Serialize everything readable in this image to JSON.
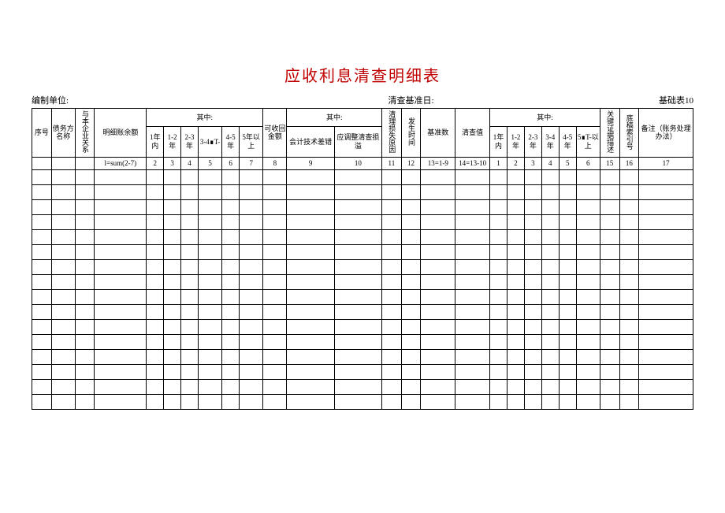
{
  "title": "应收利息清查明细表",
  "meta": {
    "left_label": "编制单位:",
    "center_label": "清查基准日:",
    "right_label": "基础表10"
  },
  "headers": {
    "seq": "序号",
    "debtor": "债务方名称",
    "relation": "与本企业关系",
    "balance": "明细账余额",
    "qizhong": "其中:",
    "y1": "1年内",
    "y12": "1-2年",
    "y23": "2-3年",
    "y34": "3-4年",
    "y34t": "3-4∎T-",
    "y45": "4-5年",
    "y5p": "5年以上",
    "y5pt": "5∎T-以上",
    "recoverable": "可收回金额",
    "acct_err": "会计技术差错",
    "adj_loss": "应调整清查损溢",
    "loss_reason": "清理损失原因",
    "occur_time": "发生时间",
    "base_num": "基准数",
    "audit_val": "清查值",
    "evidence": "关键证据描述",
    "ref_no": "底稿索引号",
    "remark": "备注（账务处理办法）"
  },
  "row_nums": {
    "c1": "l=sum(2-7)",
    "c2": "2",
    "c3": "3",
    "c4": "4",
    "c5": "5",
    "c6": "6",
    "c7": "7",
    "c8": "8",
    "c9": "9",
    "c10": "10",
    "c11": "11",
    "c12": "12",
    "c13": "13=1-9",
    "c14": "14=13-10",
    "d1": "1",
    "d2": "2",
    "d3": "3",
    "d4": "4",
    "d5": "5",
    "d6": "6",
    "c15": "15",
    "c16": "16",
    "c17": "17"
  },
  "empty_rows": 16
}
